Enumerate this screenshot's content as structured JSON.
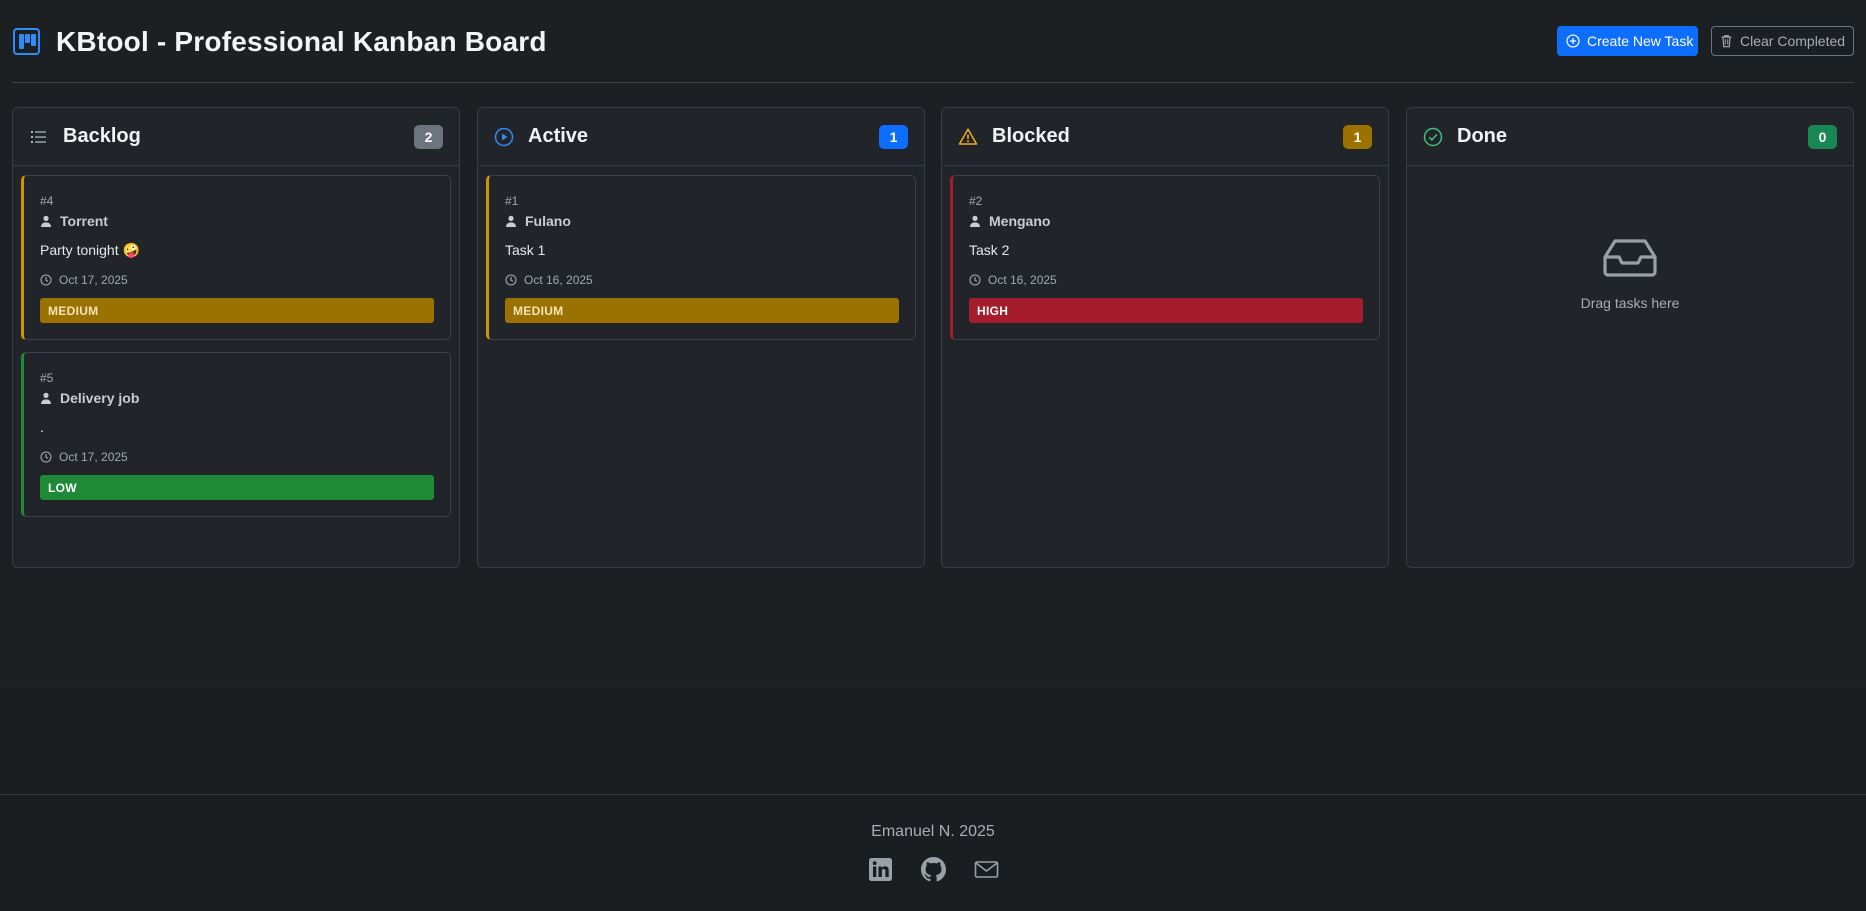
{
  "app": {
    "title": "KBtool - Professional Kanban Board",
    "logo_icon": "kanban-icon"
  },
  "toolbar": {
    "create_label": "Create New Task",
    "create_icon": "plus-circle-icon",
    "clear_label": "Clear Completed",
    "clear_icon": "trash-icon"
  },
  "columns": [
    {
      "title": "Backlog",
      "count": "2",
      "icon": "list-icon",
      "color": "#6c757d",
      "cards": [
        {
          "id": "#4",
          "assignee": "Torrent",
          "description": "Party tonight 🤪",
          "date": "Oct 17, 2025",
          "priority": "MEDIUM",
          "color": "#c99700"
        },
        {
          "id": "#5",
          "assignee": "Delivery job",
          "description": ".",
          "date": "Oct 17, 2025",
          "priority": "LOW",
          "color": "#1f8a36"
        }
      ]
    },
    {
      "title": "Active",
      "count": "1",
      "icon": "play-circle-icon",
      "color": "#0d6efd",
      "cards": [
        {
          "id": "#1",
          "assignee": "Fulano",
          "description": "Task 1",
          "date": "Oct 16, 2025",
          "priority": "MEDIUM",
          "color": "#c99700"
        }
      ]
    },
    {
      "title": "Blocked",
      "count": "1",
      "icon": "warning-icon",
      "color": "#9b7100",
      "cards": [
        {
          "id": "#2",
          "assignee": "Mengano",
          "description": "Task 2",
          "date": "Oct 16, 2025",
          "priority": "HIGH",
          "color": "#a51d2d"
        }
      ]
    },
    {
      "title": "Done",
      "count": "0",
      "icon": "check-circle-icon",
      "color": "#198754",
      "cards": [],
      "empty_text": "Drag tasks here",
      "empty_icon": "inbox-icon"
    }
  ],
  "footer": {
    "credit": "Emanuel N. 2025",
    "links": [
      "linkedin-icon",
      "github-icon",
      "mail-icon"
    ]
  }
}
